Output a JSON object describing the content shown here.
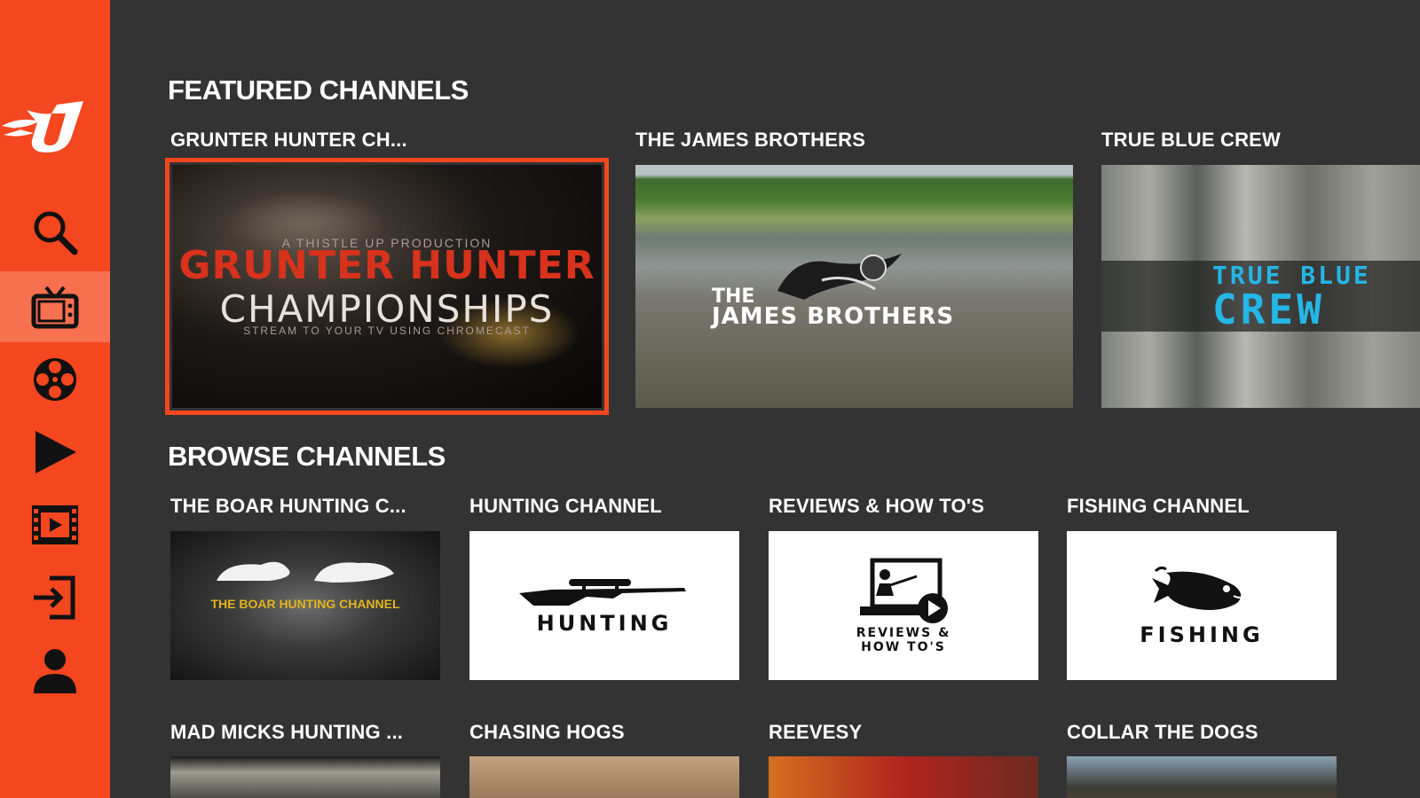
{
  "sidebar": {
    "logo": "U",
    "items": [
      {
        "name": "search",
        "icon": "search-icon"
      },
      {
        "name": "live-tv",
        "icon": "tv-icon",
        "active": true
      },
      {
        "name": "movies",
        "icon": "film-reel-icon"
      },
      {
        "name": "play",
        "icon": "play-icon"
      },
      {
        "name": "videos",
        "icon": "film-strip-icon"
      },
      {
        "name": "sign-in",
        "icon": "sign-in-icon"
      },
      {
        "name": "account",
        "icon": "user-icon"
      }
    ]
  },
  "featured": {
    "title": "FEATURED CHANNELS",
    "tiles": [
      {
        "label": "GRUNTER HUNTER CH...",
        "art_small": "A THISTLE UP PRODUCTION",
        "art_line1": "GRUNTER HUNTER",
        "art_line2": "CHAMPIONSHIPS",
        "art_small2": "STREAM TO YOUR TV USING CHROMECAST"
      },
      {
        "label": "THE JAMES BROTHERS",
        "art_line1": "THE",
        "art_line2": "JAMES BROTHERS"
      },
      {
        "label": "TRUE BLUE CREW",
        "art_line1": "TRUE BLUE",
        "art_line2": "CREW"
      }
    ]
  },
  "browse": {
    "title": "BROWSE CHANNELS",
    "tiles": [
      {
        "label": "THE BOAR HUNTING C...",
        "art_text": "THE BOAR HUNTING CHANNEL"
      },
      {
        "label": "HUNTING CHANNEL",
        "art_text": "HUNTING"
      },
      {
        "label": "REVIEWS & HOW TO'S",
        "art_line1": "REVIEWS &",
        "art_line2": "HOW TO'S"
      },
      {
        "label": "FISHING CHANNEL",
        "art_text": "FISHING"
      },
      {
        "label": "MAD MICKS HUNTING ..."
      },
      {
        "label": "CHASING HOGS"
      },
      {
        "label": "REEVESY"
      },
      {
        "label": "COLLAR THE DOGS"
      }
    ]
  },
  "colors": {
    "accent": "#f4461f",
    "background": "#333333",
    "text": "#ffffff",
    "true_blue": "#24b6e6"
  }
}
